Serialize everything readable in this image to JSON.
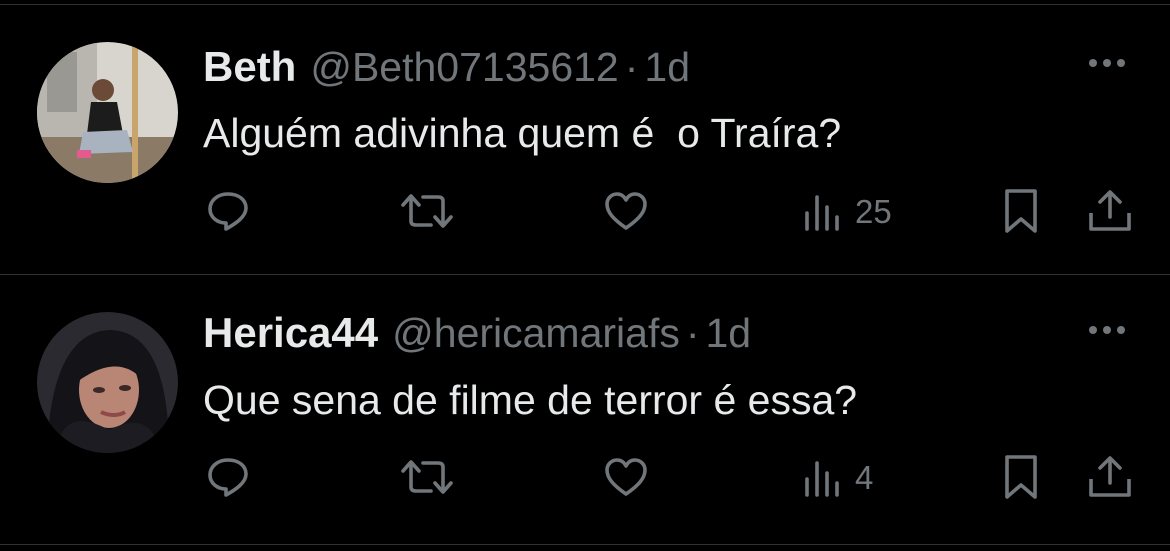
{
  "tweets": [
    {
      "display_name": "Beth",
      "handle": "@Beth07135612",
      "separator": "·",
      "time": "1d",
      "text": "Alguém adivinha quem é  o Traíra?",
      "views": "25",
      "avatar_icon": "user-avatar-photo",
      "actions": [
        "reply-icon",
        "retweet-icon",
        "like-icon",
        "views-icon",
        "bookmark-icon",
        "share-icon"
      ]
    },
    {
      "display_name": "Herica44",
      "handle": "@hericamariafs",
      "separator": "·",
      "time": "1d",
      "text": "Que sena de filme de terror é essa?",
      "views": "4",
      "avatar_icon": "user-avatar-photo",
      "actions": [
        "reply-icon",
        "retweet-icon",
        "like-icon",
        "views-icon",
        "bookmark-icon",
        "share-icon"
      ]
    }
  ],
  "colors": {
    "background": "#000000",
    "primary_text": "#e7e9ea",
    "secondary_text": "#71767b",
    "divider": "#2f3336"
  }
}
